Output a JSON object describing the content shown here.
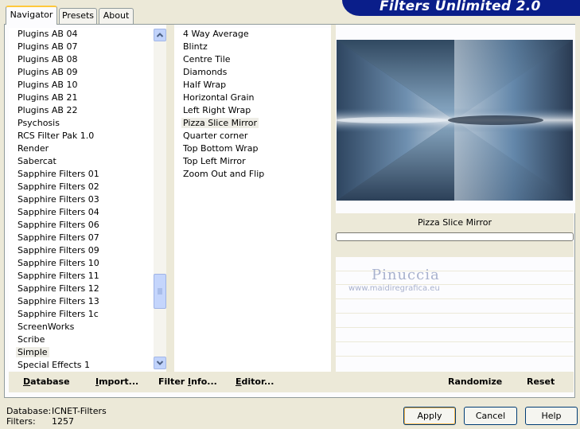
{
  "tabs": [
    {
      "label": "Navigator",
      "active": true
    },
    {
      "label": "Presets",
      "active": false
    },
    {
      "label": "About",
      "active": false
    }
  ],
  "app_title": "Filters Unlimited 2.0",
  "categories": [
    "Plugins AB 04",
    "Plugins AB 07",
    "Plugins AB 08",
    "Plugins AB 09",
    "Plugins AB 10",
    "Plugins AB 21",
    "Plugins AB 22",
    "Psychosis",
    "RCS Filter Pak 1.0",
    "Render",
    "Sabercat",
    "Sapphire Filters 01",
    "Sapphire Filters 02",
    "Sapphire Filters 03",
    "Sapphire Filters 04",
    "Sapphire Filters 06",
    "Sapphire Filters 07",
    "Sapphire Filters 09",
    "Sapphire Filters 10",
    "Sapphire Filters 11",
    "Sapphire Filters 12",
    "Sapphire Filters 13",
    "Sapphire Filters 1c",
    "ScreenWorks",
    "Scribe",
    "Simple",
    "Special Effects 1"
  ],
  "selected_category": "Simple",
  "filters": [
    "4 Way Average",
    "Blintz",
    "Centre Tile",
    "Diamonds",
    "Half Wrap",
    "Horizontal Grain",
    "Left Right Wrap",
    "Pizza Slice Mirror",
    "Quarter corner",
    "Top Bottom Wrap",
    "Top Left Mirror",
    "Zoom Out and Flip"
  ],
  "selected_filter": "Pizza Slice Mirror",
  "preview_filter_name": "Pizza Slice Mirror",
  "progress": 0,
  "watermark": {
    "name": "Pinuccia",
    "url": "www.maidiregrafica.eu"
  },
  "left_buttons": {
    "database": {
      "label": "Database",
      "accel": "D",
      "rest": "atabase"
    },
    "import": {
      "label": "Import...",
      "accel": "I",
      "rest": "mport..."
    },
    "filter_info": {
      "label": "Filter Info...",
      "pre": "Filter ",
      "accel": "I",
      "rest": "nfo..."
    },
    "editor": {
      "label": "Editor...",
      "accel": "E",
      "rest": "ditor..."
    }
  },
  "right_buttons": {
    "randomize": "Randomize",
    "reset": "Reset"
  },
  "status": {
    "database_label": "Database:",
    "database_value": "ICNET-Filters",
    "filters_label": "Filters:",
    "filters_value": "1257"
  },
  "dialog_buttons": {
    "apply": "Apply",
    "cancel": "Cancel",
    "help": "Help"
  },
  "colors": {
    "accent": "#0a1e8a",
    "face": "#ece9d8",
    "tab_highlight": "#ffc83c"
  }
}
